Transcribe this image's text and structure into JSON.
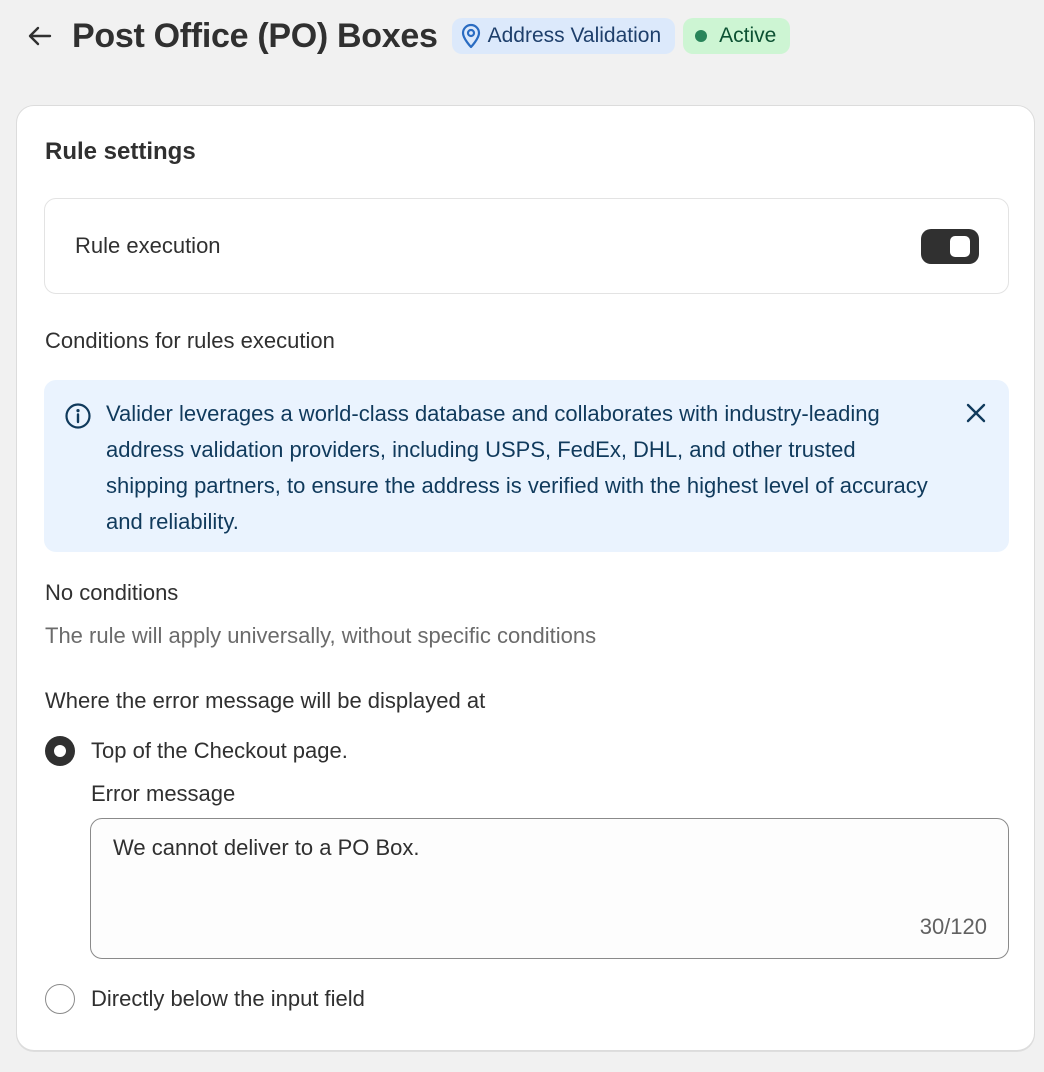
{
  "header": {
    "title": "Post Office (PO) Boxes",
    "back_icon": "arrow-left-icon",
    "badges": {
      "type_label": "Address Validation",
      "type_icon": "location-pin-icon",
      "status_label": "Active"
    }
  },
  "colors": {
    "info_badge_bg": "#dce9fb",
    "success_badge_bg": "#cdf5d3",
    "banner_bg": "#eaf3fe",
    "toggle_on": "#303030"
  },
  "card": {
    "title": "Rule settings",
    "rule_execution": {
      "label": "Rule execution",
      "enabled": true
    },
    "conditions_heading": "Conditions for rules execution",
    "banner": {
      "icon": "info-circle-icon",
      "text": "Valider leverages a world-class database and collaborates with industry-leading address validation providers, including USPS, FedEx, DHL, and other trusted shipping partners, to ensure the address is verified with the highest level of accuracy and reliability.",
      "close_icon": "close-icon"
    },
    "no_conditions": {
      "title": "No conditions",
      "description": "The rule will apply universally, without specific conditions"
    },
    "display_heading": "Where the error message will be displayed at",
    "display_options": [
      {
        "label": "Top of the Checkout page.",
        "selected": true
      },
      {
        "label": "Directly below the input field",
        "selected": false
      }
    ],
    "error_message": {
      "label": "Error message",
      "value": "We cannot deliver to a PO Box.",
      "char_count": "30/120"
    }
  }
}
